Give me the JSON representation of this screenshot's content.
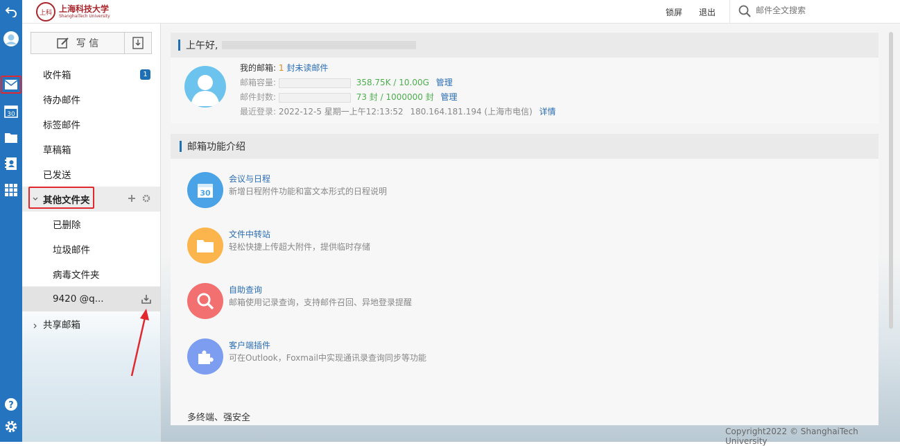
{
  "topbar": {
    "logo_cn": "上海科技大学",
    "logo_en": "ShanghaiTech University",
    "logo_seal": "上科",
    "lock_label": "锁屏",
    "logout_label": "退出",
    "search_placeholder": "邮件全文搜索"
  },
  "sidebar": {
    "compose_label": "写 信",
    "folders": [
      {
        "label": "收件箱",
        "badge": "1"
      },
      {
        "label": "待办邮件"
      },
      {
        "label": "标签邮件"
      },
      {
        "label": "草稿箱"
      },
      {
        "label": "已发送"
      },
      {
        "label": "其他文件夹"
      },
      {
        "label": "已删除"
      },
      {
        "label": "垃圾邮件"
      },
      {
        "label": "病毒文件夹"
      },
      {
        "label": "9420     @q..."
      },
      {
        "label": "共享邮箱"
      }
    ]
  },
  "welcome": {
    "greeting": "上午好,",
    "mybox_label": "我的邮箱:",
    "unread_count": "1",
    "unread_label": "封未读邮件",
    "capacity_label": "邮箱容量:",
    "capacity_value": "358.75K / 10.00G",
    "count_label": "邮件封数:",
    "count_value": "73 封 / 1000000 封",
    "manage_label": "管理",
    "last_login_label": "最近登录:",
    "last_login_value": "2022-12-5 星期一上午12:13:52",
    "last_login_ip": "180.164.181.194 (上海市电信)",
    "detail_label": "详情"
  },
  "features": {
    "title": "邮箱功能介绍",
    "items": [
      {
        "title": "会议与日程",
        "desc": "新增日程附件功能和富文本形式的日程说明",
        "color": "#4aa3e6",
        "icon": "calendar-icon",
        "glyph": "30"
      },
      {
        "title": "文件中转站",
        "desc": "轻松快捷上传超大附件，提供临时存储",
        "color": "#fbb54c",
        "icon": "folder-icon"
      },
      {
        "title": "自助查询",
        "desc": "邮箱使用记录查询，支持邮件召回、异地登录提醒",
        "color": "#f27070",
        "icon": "search-icon"
      },
      {
        "title": "客户端插件",
        "desc": "可在Outlook，Foxmail中实现通讯录查询同步等功能",
        "color": "#7c9df0",
        "icon": "puzzle-icon"
      }
    ],
    "more_title": "多终端、强安全"
  },
  "footer": "Copyright2022 © ShanghaiTech University",
  "colors": {
    "rail": "#2574bf",
    "accent": "#1f6fb5",
    "highlight": "#e0282e",
    "green": "#4cae4c"
  }
}
